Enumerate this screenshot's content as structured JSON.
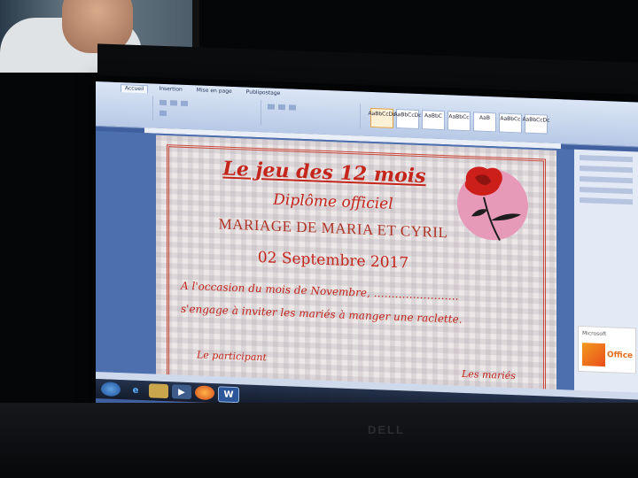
{
  "scene": {
    "background_color": "#050607",
    "screen_accent": "#3f5f9e",
    "text_color": "#c4261c",
    "brand": "DELL"
  },
  "ribbon": {
    "tabs": [
      "Accueil",
      "Insertion",
      "Mise en page",
      "Publipostage"
    ],
    "styles": [
      "AaBbCcDc",
      "AaBbCcDc",
      "AaBbC",
      "AaBbCc",
      "AaB",
      "AaBbCc",
      "AaBbCcDc"
    ]
  },
  "diploma": {
    "title": "Le jeu des 12 mois",
    "subtitle": "Diplôme officiel",
    "names": "MARIAGE DE MARIA ET CYRIL",
    "date": "02 Septembre 2017",
    "line1": "A l'occasion du mois de Novembre, ……………………",
    "line2": "s'engage à inviter les mariés à manger une raclette.",
    "signature_left": "Le participant",
    "signature_right": "Les mariés"
  },
  "promo": {
    "label": "Microsoft",
    "product": "Office"
  },
  "icons": [
    "rose-icon",
    "windows-start-icon",
    "ie-icon",
    "folder-icon",
    "media-icon",
    "firefox-icon",
    "word-icon"
  ]
}
